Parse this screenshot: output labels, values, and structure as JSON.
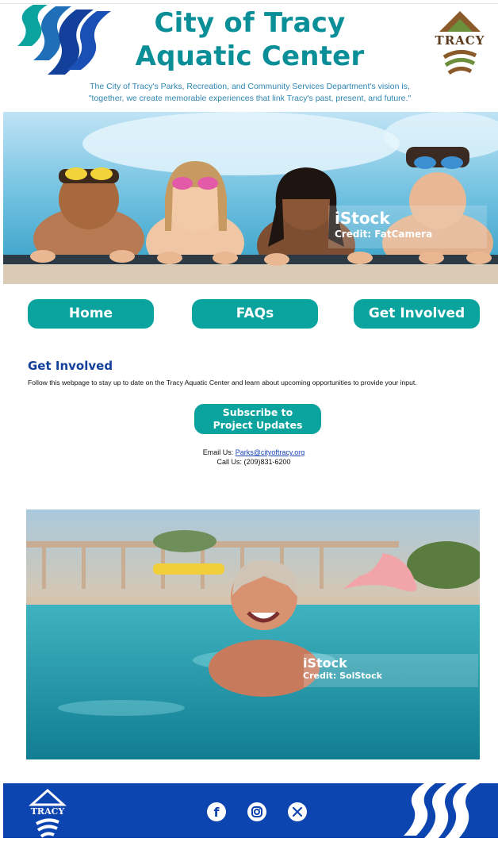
{
  "header": {
    "title_line1": "City of Tracy",
    "title_line2": "Aquatic Center",
    "vision_line1": "The City of Tracy's Parks, Recreation, and Community Services Department's vision is,",
    "vision_line2": "\"together, we create memorable experiences that link Tracy's past, present, and future.\"",
    "logo_text": "TRACY"
  },
  "hero": {
    "credit_brand": "iStock",
    "credit_text": "Credit: FatCamera"
  },
  "nav": {
    "home": "Home",
    "faqs": "FAQs",
    "get_involved": "Get Involved"
  },
  "section": {
    "heading": "Get Involved",
    "text": "Follow this webpage to stay up to date on the Tracy Aquatic Center and learn about upcoming opportunities to provide your input.",
    "subscribe_line1": "Subscribe to",
    "subscribe_line2": "Project Updates",
    "email_label": "Email Us: ",
    "email": "Parks@cityoftracy.org",
    "call_label": "Call Us: ",
    "phone": "(209)831-6200"
  },
  "photo2": {
    "credit_brand": "iStock",
    "credit_text": "Credit: SolStock"
  },
  "footer": {
    "logo_text": "TRACY",
    "social": [
      "facebook-icon",
      "instagram-icon",
      "x-icon"
    ]
  },
  "colors": {
    "teal": "#0aa39e",
    "title_teal": "#0a8f98",
    "navy": "#12409b",
    "footer_blue": "#0c45b0",
    "link_blue": "#1a44b8"
  }
}
